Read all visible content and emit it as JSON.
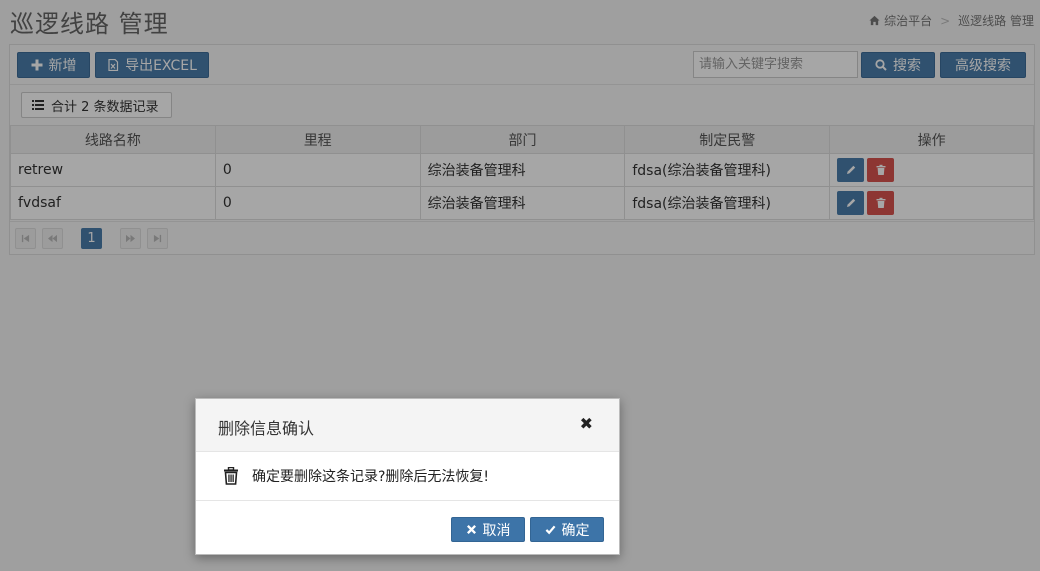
{
  "header": {
    "title": "巡逻线路 管理",
    "breadcrumb": [
      "综治平台",
      "巡逻线路 管理"
    ]
  },
  "toolbar": {
    "add_label": "新增",
    "export_label": "导出EXCEL",
    "search_placeholder": "请输入关键字搜索",
    "search_label": "搜索",
    "advanced_search_label": "高级搜索"
  },
  "summary": {
    "record_count_label": "合计 2 条数据记录"
  },
  "table": {
    "columns": [
      "线路名称",
      "里程",
      "部门",
      "制定民警",
      "操作"
    ],
    "rows": [
      {
        "name": "retrew",
        "mileage": "0",
        "department": "综治装备管理科",
        "officer": "fdsa(综治装备管理科)"
      },
      {
        "name": "fvdsaf",
        "mileage": "0",
        "department": "综治装备管理科",
        "officer": "fdsa(综治装备管理科)"
      }
    ]
  },
  "pager": {
    "current_page": "1"
  },
  "dialog": {
    "title": "删除信息确认",
    "close_glyph": "✖",
    "message": "确定要删除这条记录?删除后无法恢复!",
    "cancel_label": "取消",
    "confirm_label": "确定"
  },
  "colors": {
    "primary": "#4a7dab",
    "danger": "#d9534f",
    "overlay": "rgba(0,0,0,0.35)"
  }
}
